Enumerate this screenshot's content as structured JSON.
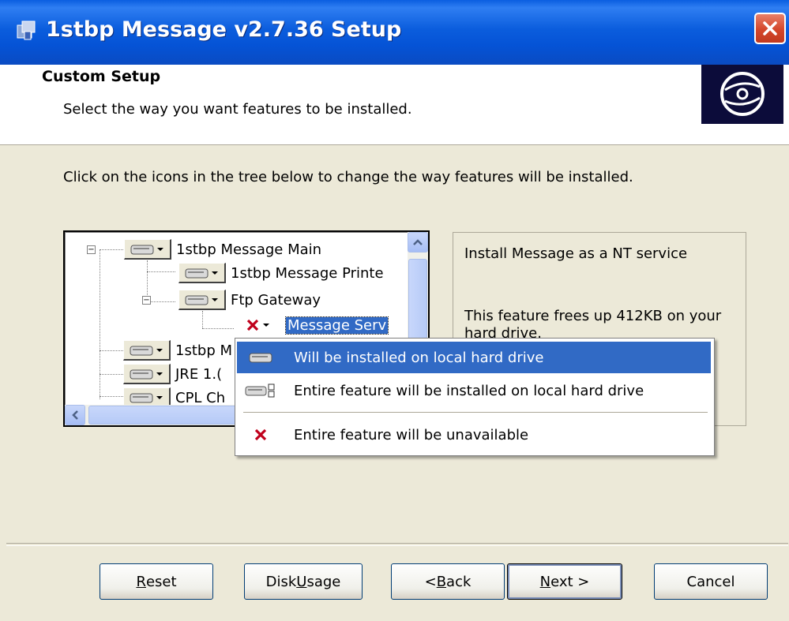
{
  "window": {
    "title": "1stbp Message v2.7.36 Setup"
  },
  "header": {
    "title": "Custom Setup",
    "subtitle": "Select the way you want features to be installed."
  },
  "instruction": "Click on the icons in the tree below to change the way features will be installed.",
  "tree": {
    "items": [
      {
        "label": "1stbp Message Main",
        "toggle": "−"
      },
      {
        "label": "1stbp Message Printe"
      },
      {
        "label": "Ftp Gateway",
        "toggle": "−"
      },
      {
        "label": "Message Serv"
      },
      {
        "label": "1stbp M"
      },
      {
        "label": "JRE 1.("
      },
      {
        "label": "CPL Ch"
      }
    ]
  },
  "description": {
    "line1": "Install Message as a NT service",
    "line2": "This feature frees up 412KB on your hard drive."
  },
  "menu": {
    "items": [
      {
        "label": "Will be installed on local hard drive",
        "icon": "drive-icon",
        "highlighted": true
      },
      {
        "label": "Entire feature will be installed on local hard drive",
        "icon": "drive-tree-icon"
      },
      {
        "label": "Entire feature will be unavailable",
        "icon": "red-x-icon"
      }
    ]
  },
  "buttons": {
    "reset": {
      "pre": "",
      "ul": "R",
      "post": "eset"
    },
    "disk": {
      "pre": "Disk ",
      "ul": "U",
      "post": "sage"
    },
    "back": {
      "pre": "< ",
      "ul": "B",
      "post": "ack"
    },
    "next": {
      "pre": "",
      "ul": "N",
      "post": "ext >"
    },
    "cancel": {
      "label": "Cancel"
    }
  },
  "colors": {
    "titlebar": "#0553d6",
    "highlight": "#316ac5",
    "unavailable": "#c0001c"
  }
}
